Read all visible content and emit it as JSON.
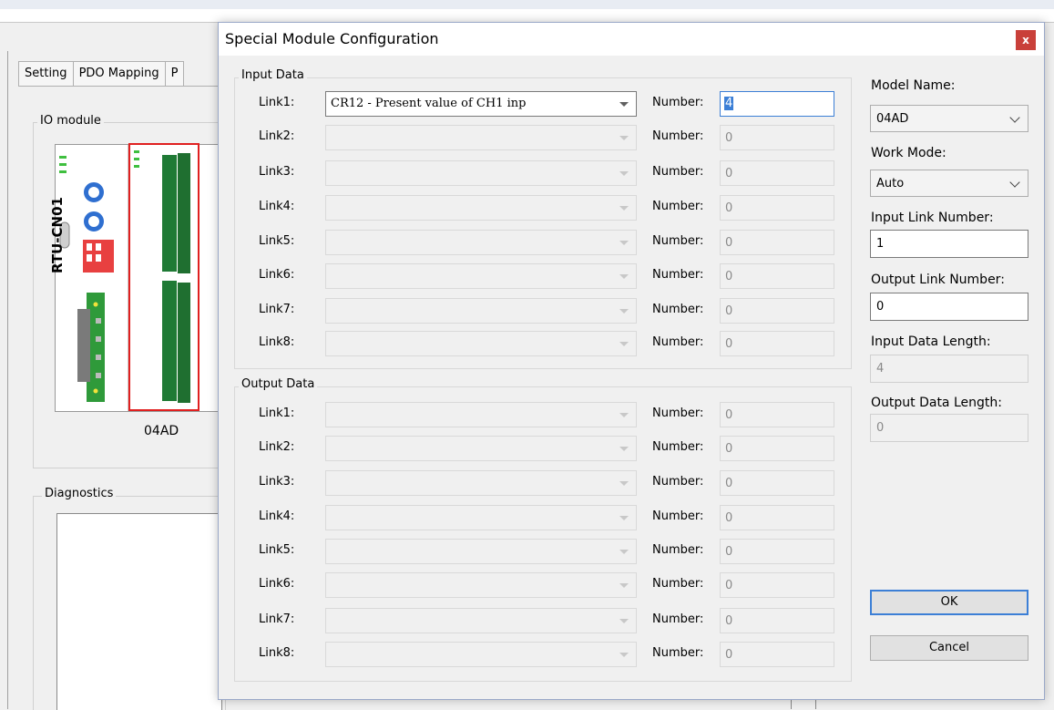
{
  "background": {
    "tabs": [
      "Setting",
      "PDO Mapping",
      "P"
    ],
    "io_module_title": "IO module",
    "module_label": "04AD",
    "device_label": "RTU-CN01",
    "diagnostics_title": "Diagnostics"
  },
  "dialog": {
    "title": "Special Module Configuration",
    "close_glyph": "x",
    "input_group_title": "Input Data",
    "output_group_title": "Output Data",
    "number_label": "Number:",
    "input_links": [
      {
        "label": "Link1:",
        "value": "CR12 - Present value of CH1 inp",
        "number": "4"
      },
      {
        "label": "Link2:",
        "value": "",
        "number": "0"
      },
      {
        "label": "Link3:",
        "value": "",
        "number": "0"
      },
      {
        "label": "Link4:",
        "value": "",
        "number": "0"
      },
      {
        "label": "Link5:",
        "value": "",
        "number": "0"
      },
      {
        "label": "Link6:",
        "value": "",
        "number": "0"
      },
      {
        "label": "Link7:",
        "value": "",
        "number": "0"
      },
      {
        "label": "Link8:",
        "value": "",
        "number": "0"
      }
    ],
    "output_links": [
      {
        "label": "Link1:",
        "value": "",
        "number": "0"
      },
      {
        "label": "Link2:",
        "value": "",
        "number": "0"
      },
      {
        "label": "Link3:",
        "value": "",
        "number": "0"
      },
      {
        "label": "Link4:",
        "value": "",
        "number": "0"
      },
      {
        "label": "Link5:",
        "value": "",
        "number": "0"
      },
      {
        "label": "Link6:",
        "value": "",
        "number": "0"
      },
      {
        "label": "Link7:",
        "value": "",
        "number": "0"
      },
      {
        "label": "Link8:",
        "value": "",
        "number": "0"
      }
    ],
    "side": {
      "model_name_label": "Model Name:",
      "model_name_value": "04AD",
      "work_mode_label": "Work Mode:",
      "work_mode_value": "Auto",
      "input_link_number_label": "Input Link Number:",
      "input_link_number_value": "1",
      "output_link_number_label": "Output Link Number:",
      "output_link_number_value": "0",
      "input_data_length_label": "Input Data Length:",
      "input_data_length_value": "4",
      "output_data_length_label": "Output Data Length:",
      "output_data_length_value": "0",
      "ok_label": "OK",
      "cancel_label": "Cancel"
    }
  },
  "colors": {
    "accent": "#3c7fd6",
    "close_button": "#c9403a",
    "highlight_box": "#e02020",
    "terminal_green": "#1f7a35"
  }
}
